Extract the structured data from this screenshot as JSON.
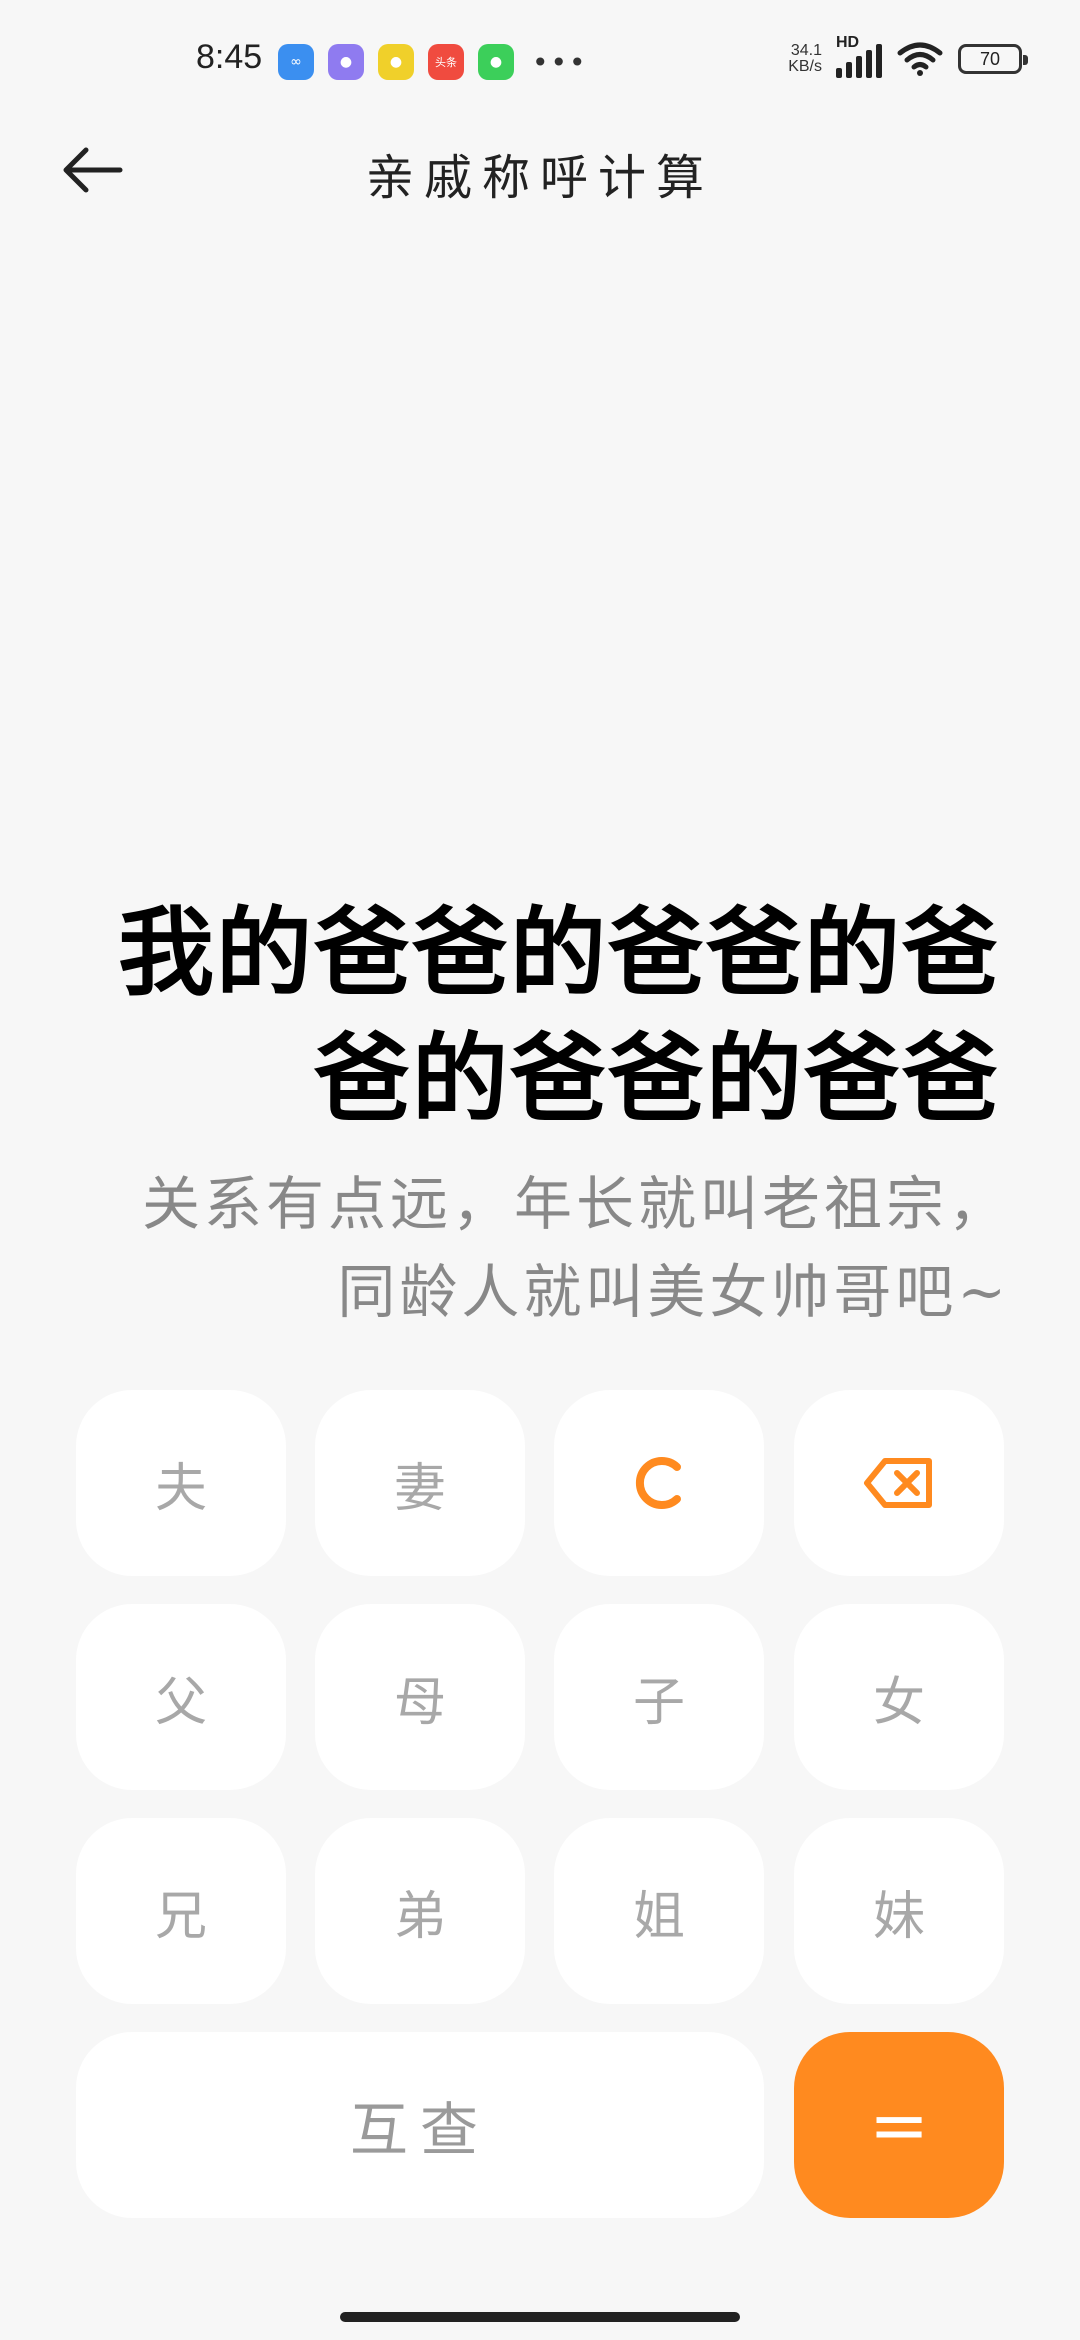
{
  "status_bar": {
    "time": "8:45",
    "apps": [
      {
        "icon": "baidu-app-icon",
        "glyph": "∞",
        "color": "#3b8ff0"
      },
      {
        "icon": "browser-app-icon",
        "glyph": "●",
        "color": "#8f7bf0"
      },
      {
        "icon": "qq-app-icon",
        "glyph": "●",
        "color": "#f0d02a"
      },
      {
        "icon": "toutiao-app-icon",
        "glyph": "头条",
        "color": "#f04b3f"
      },
      {
        "icon": "wechat-app-icon",
        "glyph": "●",
        "color": "#3ccf5a"
      }
    ],
    "more": "•••",
    "net_speed_value": "34.1",
    "net_speed_unit": "KB/s",
    "hd": "HD",
    "battery": "70"
  },
  "app_bar": {
    "back_icon": "arrow-left-icon",
    "title": "亲戚称呼计算"
  },
  "display": {
    "result_line1": "我的爸爸的爸爸的爸",
    "result_line2": "爸的爸爸的爸爸",
    "note_line1": "关系有点远，年长就叫老祖宗，",
    "note_line2": "同龄人就叫美女帅哥吧~"
  },
  "keypad": {
    "husband": "夫",
    "wife": "妻",
    "clear_icon": "clear-c-icon",
    "backspace_icon": "backspace-icon",
    "father": "父",
    "mother": "母",
    "son": "子",
    "daughter": "女",
    "elder_brother": "兄",
    "younger_brother": "弟",
    "elder_sister": "姐",
    "younger_sister": "妹",
    "mutual": "互查",
    "equals": "="
  },
  "colors": {
    "accent": "#ff8a1f",
    "background": "#f7f7f7",
    "key_bg": "#ffffff",
    "key_text": "#a8a8a8"
  }
}
